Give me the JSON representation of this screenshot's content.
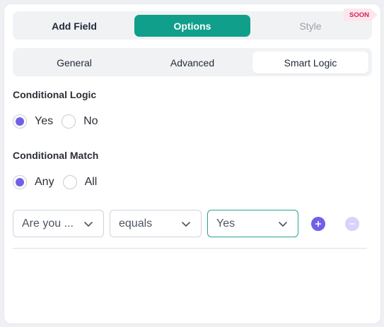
{
  "tabs_main": [
    {
      "label": "Add Field"
    },
    {
      "label": "Options"
    },
    {
      "label": "Style"
    }
  ],
  "soon_badge": "SOON",
  "tabs_sub": [
    {
      "label": "General"
    },
    {
      "label": "Advanced"
    },
    {
      "label": "Smart Logic"
    }
  ],
  "conditional_logic": {
    "label": "Conditional Logic",
    "options": [
      "Yes",
      "No"
    ],
    "selected": "Yes"
  },
  "conditional_match": {
    "label": "Conditional Match",
    "options": [
      "Any",
      "All"
    ],
    "selected": "Any"
  },
  "rule": {
    "field": "Are you ...",
    "operator": "equals",
    "value": "Yes"
  },
  "colors": {
    "accent": "#0f9f8b",
    "radio": "#7060e8",
    "badge_bg": "#fde7ec",
    "badge_text": "#d0245a"
  }
}
